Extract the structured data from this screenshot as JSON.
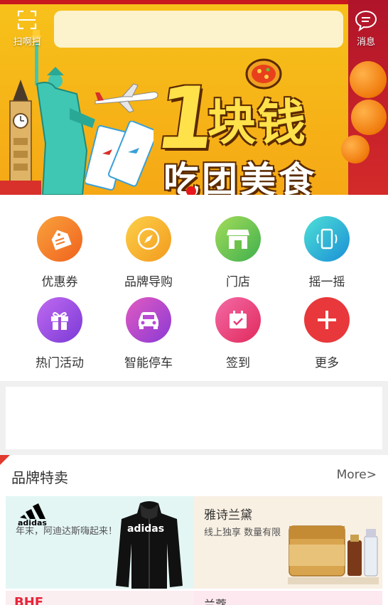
{
  "topbar": {
    "scan_label": "扫啊扫",
    "search_placeholder": "",
    "message_label": "消息"
  },
  "banner": {
    "big_number": "1",
    "title": "块钱",
    "subtitle": "吃团美食"
  },
  "grid": {
    "items": [
      {
        "label": "优惠券",
        "icon": "coupon-icon",
        "color": "#f47c2a"
      },
      {
        "label": "品牌导购",
        "icon": "compass-icon",
        "color": "#f5a623"
      },
      {
        "label": "门店",
        "icon": "store-icon",
        "color": "#6ec24a"
      },
      {
        "label": "摇一摇",
        "icon": "phone-shake-icon",
        "color": "#1fb6d6"
      },
      {
        "label": "热门活动",
        "icon": "gift-icon",
        "color": "#9b4fd6"
      },
      {
        "label": "智能停车",
        "icon": "car-icon",
        "color": "#b84ad6"
      },
      {
        "label": "签到",
        "icon": "calendar-check-icon",
        "color": "#ea3b7c"
      },
      {
        "label": "更多",
        "icon": "plus-icon",
        "color": "#e8383b"
      }
    ]
  },
  "brand_section": {
    "title": "品牌特卖",
    "more_label": "More>",
    "tiles": [
      {
        "brand": "adidas",
        "desc": "年末，阿迪达斯嗨起来！",
        "bg": "#e3f6f4"
      },
      {
        "brand": "雅诗兰黛",
        "desc": "线上独享 数量有限",
        "bg": "#f8f0e3"
      },
      {
        "brand": "BHF",
        "desc": "",
        "bg": "#fbeef0"
      },
      {
        "brand": "兰蔻",
        "desc": "",
        "bg": "#fde8ef"
      }
    ]
  }
}
